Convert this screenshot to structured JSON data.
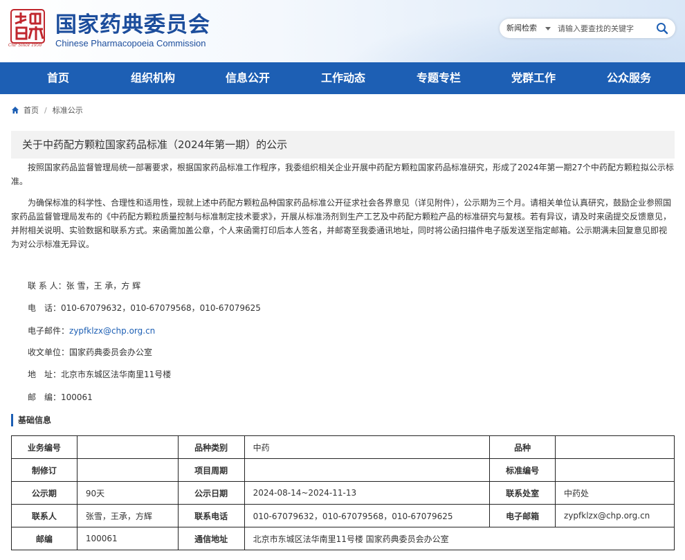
{
  "header": {
    "logo_caption": "ChP Since 1950",
    "title_cn": "国家药典委员会",
    "title_en": "Chinese Pharmacopoeia Commission"
  },
  "search": {
    "category": "新闻检索",
    "placeholder": "请输入要查找的关键字",
    "icon": "search-icon"
  },
  "nav": {
    "items": [
      "首页",
      "组织机构",
      "信息公开",
      "工作动态",
      "专题专栏",
      "党群工作",
      "公众服务"
    ]
  },
  "breadcrumb": {
    "home": "首页",
    "current": "标准公示"
  },
  "article": {
    "title": "关于中药配方颗粒国家药品标准（2024年第一期）的公示",
    "p1": "按照国家药品监督管理局统一部署要求，根据国家药品标准工作程序，我委组织相关企业开展中药配方颗粒国家药品标准研究，形成了2024年第一期27个中药配方颗粒拟公示标准。",
    "p2": "为确保标准的科学性、合理性和适用性，现就上述中药配方颗粒品种国家药品标准公开征求社会各界意见（详见附件），公示期为三个月。请相关单位认真研究，鼓励企业参照国家药品监督管理局发布的《中药配方颗粒质量控制与标准制定技术要求》，开展从标准汤剂到生产工艺及中药配方颗粒产品的标准研究与复核。若有异议，请及时来函提交反馈意见，并附相关说明、实验数据和联系方式。来函需加盖公章，个人来函需打印后本人签名，并邮寄至我委通讯地址，同时将公函扫描件电子版发送至指定邮箱。公示期满未回复意见即视为对公示标准无异议。",
    "contacts": {
      "person": "联 系 人：张 雪，王 承，方 辉",
      "phone": "电　话：010-67079632，010-67079568，010-67079625",
      "email_label": "电子邮件：",
      "email": "zypfklzx@chp.org.cn",
      "receiver": "收文单位：国家药典委员会办公室",
      "address": "地　址：北京市东城区法华南里11号楼",
      "postcode": "邮　编：100061"
    }
  },
  "basic_info": {
    "heading": "基础信息",
    "rows": [
      [
        {
          "label": "业务编号",
          "value": ""
        },
        {
          "label": "品种类别",
          "value": "中药"
        },
        {
          "label": "品种",
          "value": ""
        }
      ],
      [
        {
          "label": "制修订",
          "value": ""
        },
        {
          "label": "项目周期",
          "value": ""
        },
        {
          "label": "标准编号",
          "value": ""
        }
      ],
      [
        {
          "label": "公示期",
          "value": "90天"
        },
        {
          "label": "公示日期",
          "value": "2024-08-14~2024-11-13"
        },
        {
          "label": "联系处室",
          "value": "中药处"
        }
      ],
      [
        {
          "label": "联系人",
          "value": "张雪，王承，方辉"
        },
        {
          "label": "联系电话",
          "value": "010-67079632，010-67079568，010-67079625"
        },
        {
          "label": "电子邮箱",
          "value": "zypfklzx@chp.org.cn"
        }
      ]
    ],
    "last_row": {
      "label1": "邮编",
      "value1": "100061",
      "label2": "通信地址",
      "value2": "北京市东城区法华南里11号楼 国家药典委员会办公室"
    }
  },
  "colors": {
    "brand_blue": "#1d5fb4",
    "title_blue": "#1c4d9c",
    "seal_red": "#c0262d"
  }
}
